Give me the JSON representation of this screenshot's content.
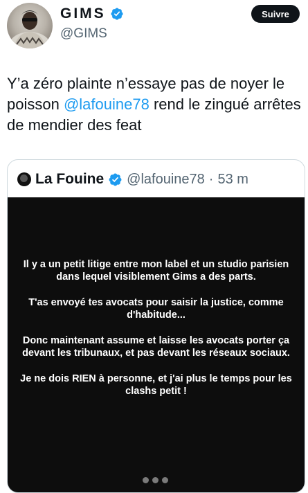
{
  "author": {
    "display_name": "GIMS",
    "handle": "@GIMS",
    "verified_icon": "verified-badge-icon"
  },
  "actions": {
    "follow_label": "Suivre"
  },
  "tweet": {
    "text_part1": "Y’a zéro plainte n’essaye pas de noyer le poisson ",
    "mention": "@lafouine78",
    "text_part2": " rend le zingué arrêtes de mendier des feat"
  },
  "quote": {
    "name": "La Fouine",
    "handle": "@lafouine78",
    "separator": "·",
    "time": "53 m",
    "media_paragraphs": [
      "Il y a un petit litige entre mon label et un studio parisien dans lequel visiblement Gims a des parts.",
      "T'as envoyé tes avocats pour saisir la justice, comme d'habitude...",
      "Donc maintenant assume et laisse les avocats porter ça devant les tribunaux, et pas devant les réseaux sociaux.",
      "Je ne dois RIEN à personne, et j'ai plus le temps pour les clashs petit !"
    ]
  },
  "colors": {
    "accent": "#1d9bf0",
    "text": "#0f1419",
    "muted": "#536471",
    "media_bg": "#0d0d0d"
  }
}
